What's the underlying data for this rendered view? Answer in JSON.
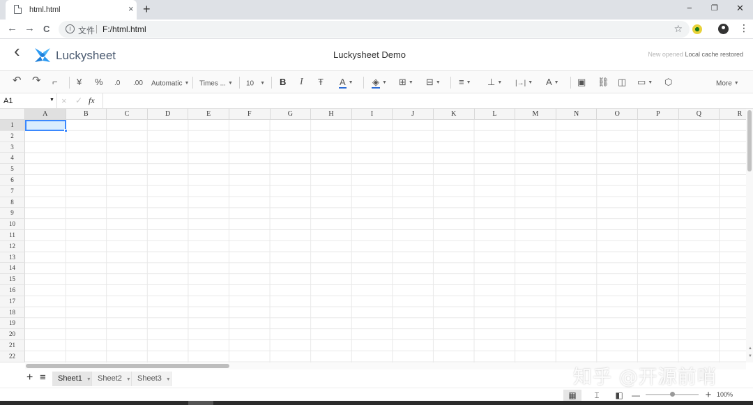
{
  "browser": {
    "tab_title": "html.html",
    "tab_close": "×",
    "new_tab": "+",
    "window_minimize": "−",
    "window_restore": "❐",
    "window_close": "✕",
    "nav_back": "←",
    "nav_forward": "→",
    "nav_reload": "C",
    "scheme_label": "文件",
    "url": "F:/html.html",
    "star": "☆",
    "menu": "⋮"
  },
  "header": {
    "back": "‹",
    "logo_text": "Luckysheet",
    "title": "Luckysheet Demo",
    "cache_status_muted": "New opened",
    "cache_status": "Local cache restored"
  },
  "toolbar": {
    "undo": "↶",
    "redo": "↷",
    "format_painter": "⌐",
    "currency": "¥",
    "percent": "%",
    "decrease_decimal": ".0",
    "increase_decimal": ".00",
    "number_format": "Automatic",
    "font_family": "Times ...",
    "font_size": "10",
    "bold": "B",
    "italic": "I",
    "strikethrough": "Ŧ",
    "font_color": "A",
    "fill_color": "◈",
    "border": "⊞",
    "merge": "⊟",
    "h_align": "≡",
    "v_align": "⊥",
    "text_wrap": "|→|",
    "text_rotate": "A",
    "image": "▣",
    "link": "⛓",
    "chart": "◫",
    "comment": "▭",
    "screenshot": "⬡",
    "more": "More"
  },
  "formula_bar": {
    "cell_ref": "A1",
    "dropdown": "▼",
    "cancel": "×",
    "confirm": "✓",
    "fx": "fx"
  },
  "grid": {
    "columns": [
      "A",
      "B",
      "C",
      "D",
      "E",
      "F",
      "G",
      "H",
      "I",
      "J",
      "K",
      "L",
      "M",
      "N",
      "O",
      "P",
      "Q",
      "R"
    ],
    "rows": [
      "1",
      "2",
      "3",
      "4",
      "5",
      "6",
      "7",
      "8",
      "9",
      "10",
      "11",
      "12",
      "13",
      "14",
      "15",
      "16",
      "17",
      "18",
      "19",
      "20",
      "21",
      "22"
    ],
    "selected_cell": "A1"
  },
  "sheets": {
    "add": "+",
    "list": "≡",
    "tabs": [
      "Sheet1",
      "Sheet2",
      "Sheet3"
    ],
    "active": "Sheet1"
  },
  "statusbar": {
    "view_normal": "▦",
    "view_page_break": "⌶",
    "view_page_layout": "◧",
    "zoom_out": "—",
    "zoom_in": "+",
    "zoom": "100%"
  },
  "watermark": "知乎 @开源前哨"
}
